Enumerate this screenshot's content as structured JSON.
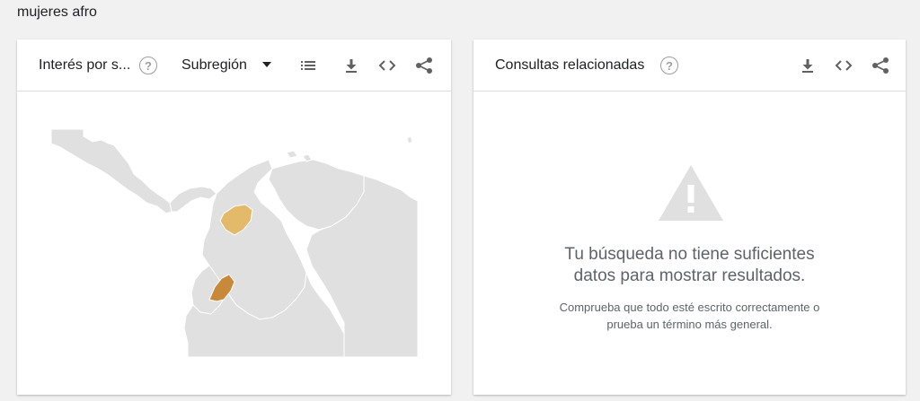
{
  "query": {
    "title": "mujeres afro"
  },
  "region_card": {
    "title": "Interés por s...",
    "help_icon": "help-circle-icon",
    "resolution_select": "Subregión",
    "icons": [
      "list-icon",
      "download-icon",
      "embed-icon",
      "share-icon"
    ],
    "map": {
      "base_color": "#e0e0e0",
      "border_color": "#ffffff",
      "highlighted_regions": [
        {
          "color": "#e3b96a"
        },
        {
          "color": "#c8893a"
        }
      ]
    }
  },
  "related_card": {
    "title": "Consultas relacionadas",
    "help_icon": "help-circle-icon",
    "icons": [
      "download-icon",
      "embed-icon",
      "share-icon"
    ],
    "empty_state": {
      "icon": "warning-icon",
      "title_line1": "Tu búsqueda no tiene suficientes",
      "title_line2": "datos para mostrar resultados.",
      "subtitle_line1": "Comprueba que todo esté escrito correctamente o",
      "subtitle_line2": "prueba un término más general."
    }
  },
  "colors": {
    "icon": "#616161",
    "muted_icon": "#9e9e9e",
    "warning": "#e0e0e0"
  }
}
